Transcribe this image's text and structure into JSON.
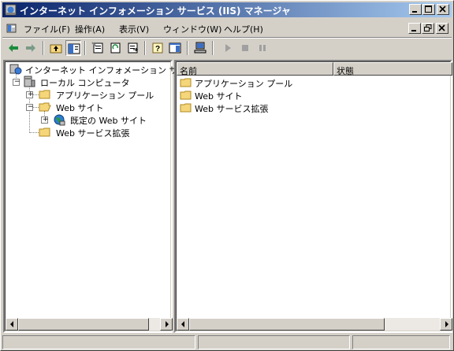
{
  "window": {
    "title": "インターネット インフォメーション サービス (IIS) マネージャ",
    "title_bg": "#0a246a"
  },
  "menu": {
    "items": [
      {
        "label": "ファイル(F)"
      },
      {
        "label": "操作(A)"
      },
      {
        "label": "表示(V)"
      },
      {
        "label": "ウィンドウ(W)"
      },
      {
        "label": "ヘルプ(H)"
      }
    ]
  },
  "toolbar": {
    "buttons": [
      "back-icon",
      "forward-icon",
      "up-folder-icon",
      "show-hide-tree-icon",
      "properties-icon",
      "refresh-icon",
      "export-list-icon",
      "help-icon",
      "console-view-icon",
      "computer-icon",
      "play-icon",
      "stop-icon",
      "pause-icon"
    ]
  },
  "tree": {
    "root": "インターネット インフォメーション サービス",
    "local_computer": "ローカル コンピュータ",
    "app_pools": "アプリケーション プール",
    "web_sites": "Web サイト",
    "default_site": "既定の Web サイト",
    "web_ext": "Web サービス拡張"
  },
  "list": {
    "columns": [
      "名前",
      "状態"
    ],
    "rows": [
      {
        "name": "アプリケーション プール",
        "icon": "folder-icon"
      },
      {
        "name": "Web サイト",
        "icon": "folder-icon"
      },
      {
        "name": "Web サービス拡張",
        "icon": "folder-icon"
      }
    ]
  },
  "colors": {
    "face": "#d4d0c8",
    "folder": "#f5d67a"
  }
}
